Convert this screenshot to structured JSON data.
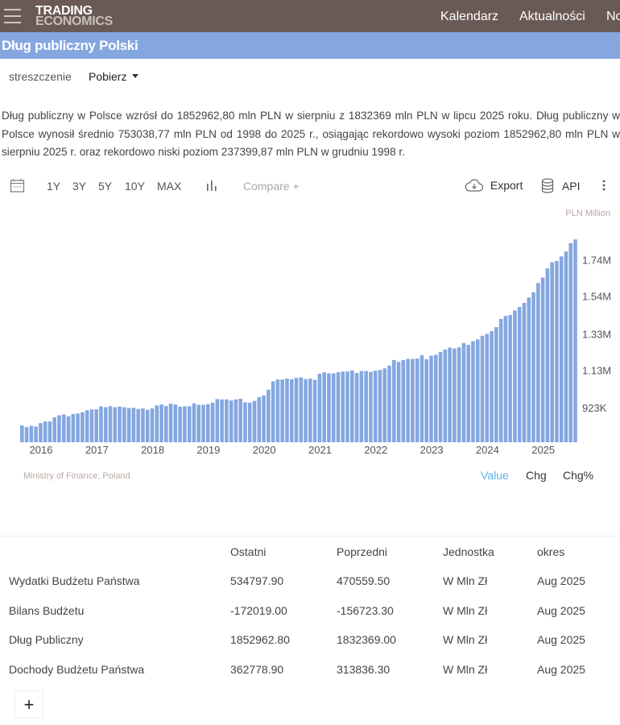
{
  "header": {
    "logo_line1": "TRADING",
    "logo_line2": "ECONOMICS",
    "nav": [
      "Kalendarz",
      "Aktualności",
      "No"
    ]
  },
  "title": "Dług publiczny Polski",
  "subnav": {
    "summary": "streszczenie",
    "download": "Pobierz"
  },
  "description": "Dług publiczny w Polsce wzrósł do 1852962,80 mln PLN w sierpniu z 1832369 mln PLN w lipcu 2025 roku. Dług publiczny w Polsce wynosił średnio 753038,77 mln PLN od 1998 do 2025 r., osiągając rekordowo wysoki poziom 1852962,80 mln PLN w sierpniu 2025 r. oraz rekordowo niski poziom 237399,87 mln PLN w grudniu 1998 r.",
  "toolbar": {
    "ranges": [
      "1Y",
      "3Y",
      "5Y",
      "10Y",
      "MAX"
    ],
    "compare": "Compare +",
    "export": "Export",
    "api": "API"
  },
  "chart_data": {
    "type": "bar",
    "unit": "PLN Million",
    "source": "Ministry of Finance, Poland",
    "start": "2015-09",
    "end": "2025-08",
    "frequency": "monthly",
    "color": "#84a7e0",
    "ylim": [
      731000,
      1860000
    ],
    "yticks": [
      {
        "v": 923000,
        "label": "923K"
      },
      {
        "v": 1130000,
        "label": "1.13M"
      },
      {
        "v": 1330000,
        "label": "1.33M"
      },
      {
        "v": 1540000,
        "label": "1.54M"
      },
      {
        "v": 1740000,
        "label": "1.74M"
      }
    ],
    "xticks": [
      "2016",
      "2017",
      "2018",
      "2019",
      "2020",
      "2021",
      "2022",
      "2023",
      "2024",
      "2025"
    ],
    "values": [
      824000,
      815000,
      822000,
      818000,
      837000,
      846000,
      846000,
      869000,
      880000,
      885000,
      875000,
      887000,
      890000,
      897000,
      908000,
      913000,
      913000,
      930000,
      925000,
      930000,
      925000,
      929000,
      925000,
      920000,
      922000,
      915000,
      918000,
      910000,
      918000,
      935000,
      940000,
      932000,
      945000,
      940000,
      928000,
      930000,
      930000,
      946000,
      938000,
      938000,
      942000,
      950000,
      970000,
      968000,
      968000,
      962000,
      968000,
      972000,
      952000,
      950000,
      960000,
      980000,
      990000,
      1022000,
      1068000,
      1078000,
      1078000,
      1083000,
      1080000,
      1087000,
      1090000,
      1080000,
      1083000,
      1076000,
      1110000,
      1118000,
      1112000,
      1112000,
      1119000,
      1122000,
      1122000,
      1128000,
      1114000,
      1125000,
      1125000,
      1120000,
      1127000,
      1131000,
      1140000,
      1155000,
      1186000,
      1176000,
      1186000,
      1192000,
      1192000,
      1194000,
      1213000,
      1190000,
      1210000,
      1215000,
      1230000,
      1244000,
      1255000,
      1250000,
      1256000,
      1280000,
      1270000,
      1290000,
      1300000,
      1320000,
      1330000,
      1346000,
      1368000,
      1413000,
      1430000,
      1435000,
      1460000,
      1479000,
      1502000,
      1531000,
      1561000,
      1612000,
      1642000,
      1693000,
      1727000,
      1734000,
      1759000,
      1786000,
      1832369,
      1852962.8
    ],
    "modes": [
      "Value",
      "Chg",
      "Chg%"
    ]
  },
  "table": {
    "headers": [
      "",
      "Ostatni",
      "Poprzedni",
      "Jednostka",
      "okres"
    ],
    "rows": [
      [
        "Wydatki Budżetu Państwa",
        "534797.90",
        "470559.50",
        "W Mln Zł",
        "Aug 2025"
      ],
      [
        "Bilans Budżetu",
        "-172019.00",
        "-156723.30",
        "W Mln Zł",
        "Aug 2025"
      ],
      [
        "Dług Publiczny",
        "1852962.80",
        "1832369.00",
        "W Mln Zł",
        "Aug 2025"
      ],
      [
        "Dochody Budżetu Państwa",
        "362778.90",
        "313836.30",
        "W Mln Zł",
        "Aug 2025"
      ]
    ],
    "add": "+"
  }
}
